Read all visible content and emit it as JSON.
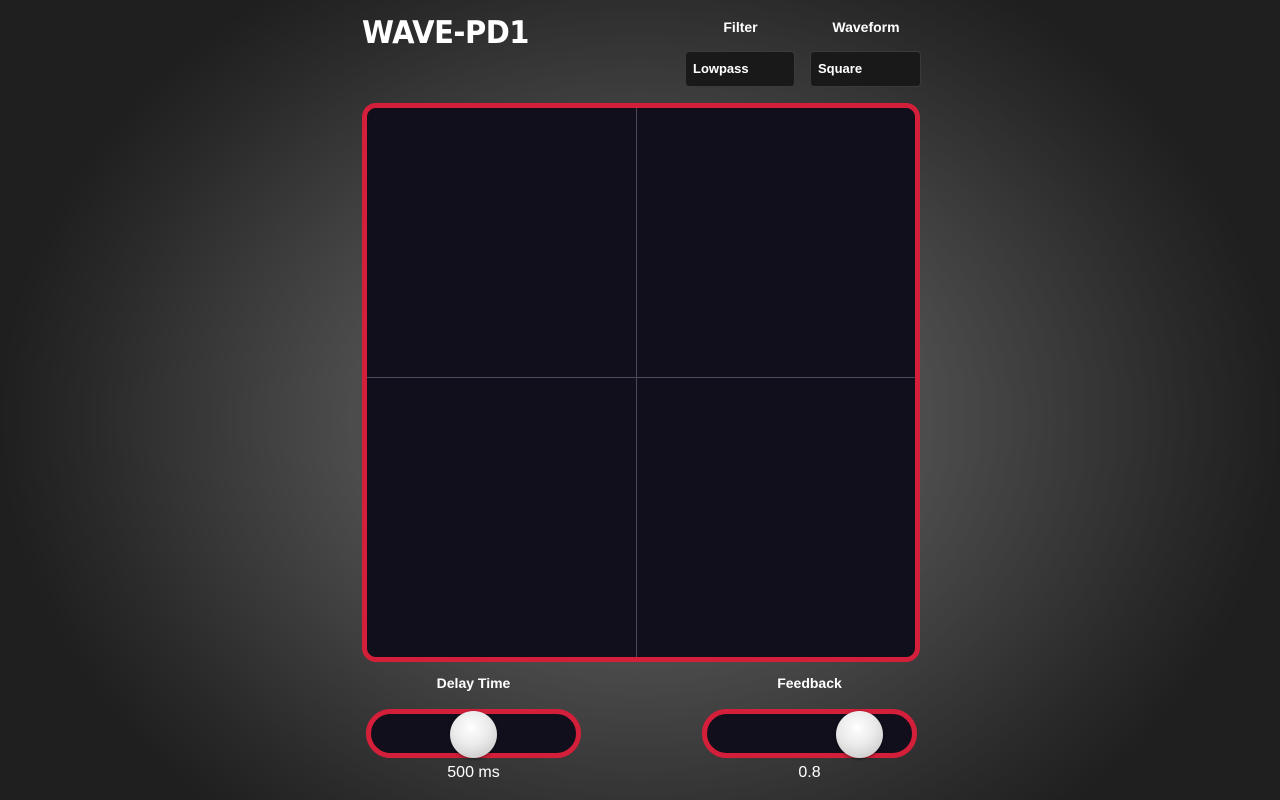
{
  "app": {
    "title": "WAVE-PD1"
  },
  "filter": {
    "label": "Filter",
    "value": "Lowpass"
  },
  "waveform": {
    "label": "Waveform",
    "value": "Square"
  },
  "xy_pad": {
    "border_color": "#d41f3a",
    "background_color": "#110f1b"
  },
  "delay_time": {
    "label": "Delay Time",
    "readout": "500 ms",
    "slider_fraction": 0.5
  },
  "feedback": {
    "label": "Feedback",
    "readout": "0.8",
    "slider_fraction": 0.8
  },
  "colors": {
    "accent": "#d41f3a",
    "panel": "#110f1b"
  }
}
